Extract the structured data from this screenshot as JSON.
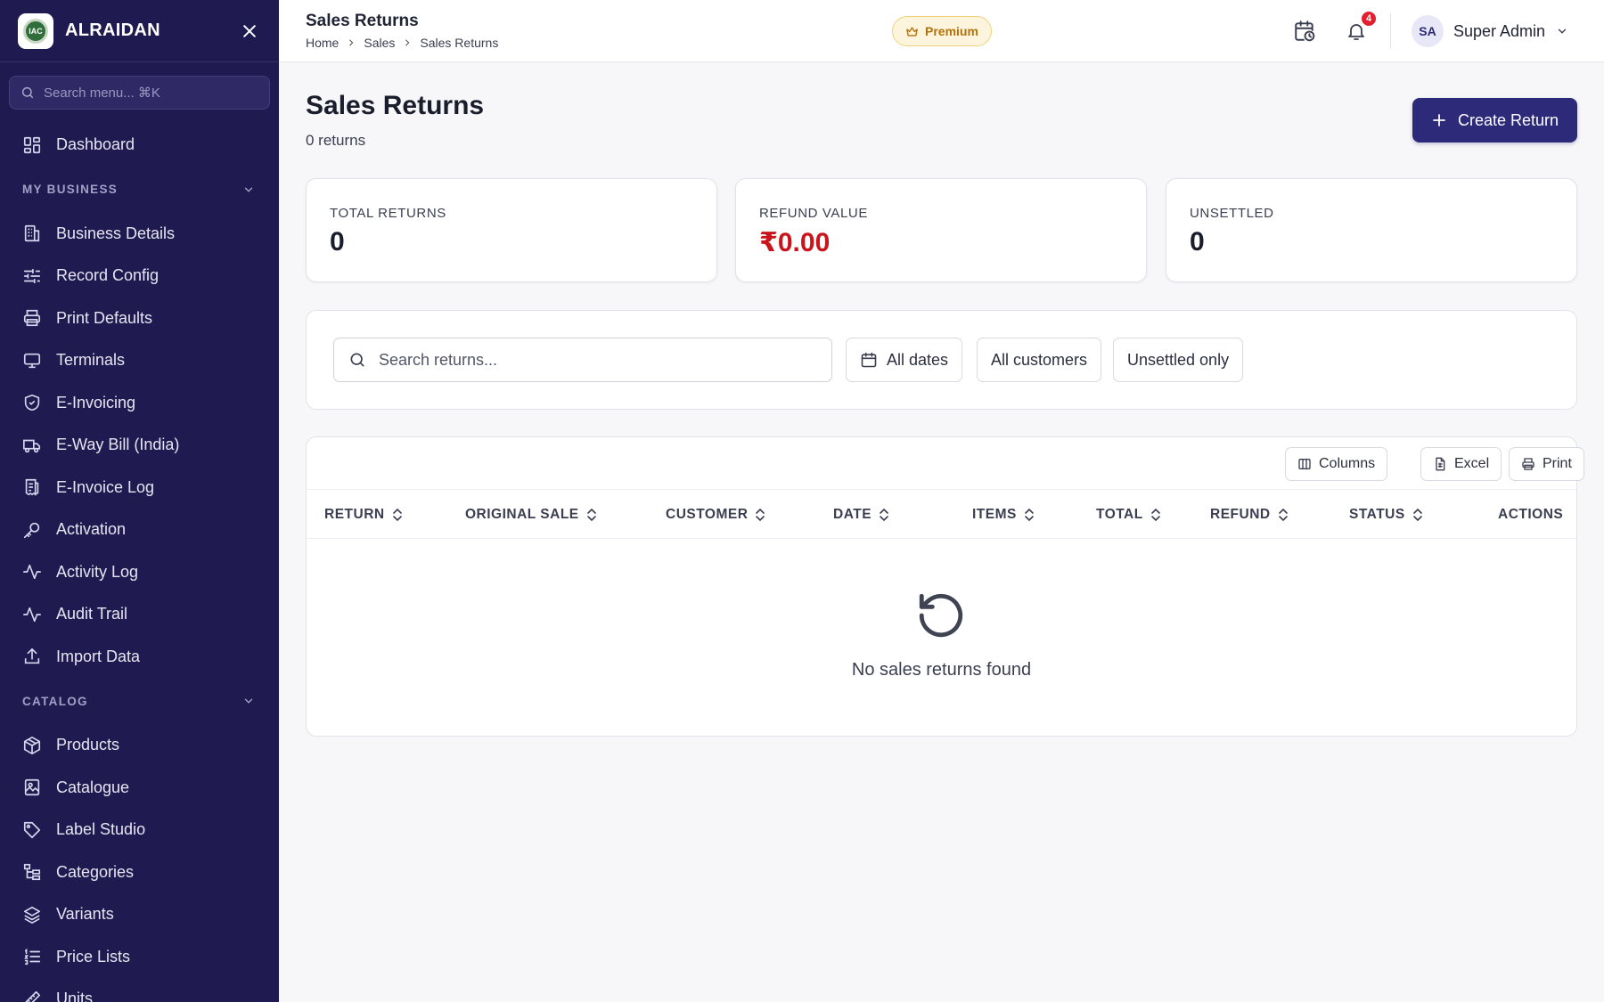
{
  "sidebar": {
    "brand_name": "ALRAIDAN",
    "logo_text": "IAC",
    "search_placeholder": "Search menu... ⌘K",
    "top_items": [
      {
        "label": "Dashboard",
        "icon": "dashboard-icon"
      }
    ],
    "sections": [
      {
        "title": "MY BUSINESS",
        "items": [
          {
            "label": "Business Details",
            "icon": "building-icon"
          },
          {
            "label": "Record Config",
            "icon": "sliders-icon"
          },
          {
            "label": "Print Defaults",
            "icon": "printer-icon"
          },
          {
            "label": "Terminals",
            "icon": "monitor-icon"
          },
          {
            "label": "E-Invoicing",
            "icon": "shield-check-icon"
          },
          {
            "label": "E-Way Bill (India)",
            "icon": "truck-icon"
          },
          {
            "label": "E-Invoice Log",
            "icon": "receipt-icon"
          },
          {
            "label": "Activation",
            "icon": "key-icon"
          },
          {
            "label": "Activity Log",
            "icon": "activity-icon"
          },
          {
            "label": "Audit Trail",
            "icon": "activity-icon"
          },
          {
            "label": "Import Data",
            "icon": "upload-icon"
          }
        ]
      },
      {
        "title": "CATALOG",
        "items": [
          {
            "label": "Products",
            "icon": "box-icon"
          },
          {
            "label": "Catalogue",
            "icon": "image-book-icon"
          },
          {
            "label": "Label Studio",
            "icon": "tag-icon"
          },
          {
            "label": "Categories",
            "icon": "tree-icon"
          },
          {
            "label": "Variants",
            "icon": "layers-icon"
          },
          {
            "label": "Price Lists",
            "icon": "list-ordered-icon"
          },
          {
            "label": "Units",
            "icon": "ruler-icon"
          }
        ]
      }
    ]
  },
  "header": {
    "title": "Sales Returns",
    "breadcrumb": [
      "Home",
      "Sales",
      "Sales Returns"
    ],
    "premium_label": "Premium",
    "notification_count": "4",
    "user_initials": "SA",
    "user_name": "Super Admin"
  },
  "page": {
    "title": "Sales Returns",
    "subtitle": "0 returns",
    "create_button": "Create Return"
  },
  "stats": [
    {
      "label": "TOTAL RETURNS",
      "value": "0"
    },
    {
      "label": "REFUND VALUE",
      "value": "₹0.00"
    },
    {
      "label": "UNSETTLED",
      "value": "0"
    }
  ],
  "filters": {
    "search_placeholder": "Search returns...",
    "dates": "All dates",
    "customers": "All customers",
    "unsettled": "Unsettled only"
  },
  "table": {
    "tools": {
      "columns": "Columns",
      "excel": "Excel",
      "print": "Print"
    },
    "columns": [
      "RETURN",
      "ORIGINAL SALE",
      "CUSTOMER",
      "DATE",
      "ITEMS",
      "TOTAL",
      "REFUND",
      "STATUS",
      "ACTIONS"
    ],
    "empty_text": "No sales returns found"
  },
  "colors": {
    "sidebar_bg": "#1f1a4f",
    "accent": "#2d2a7a",
    "refund_red": "#c9141c",
    "badge_red": "#e0202e",
    "premium_gold": "#b2720a"
  }
}
